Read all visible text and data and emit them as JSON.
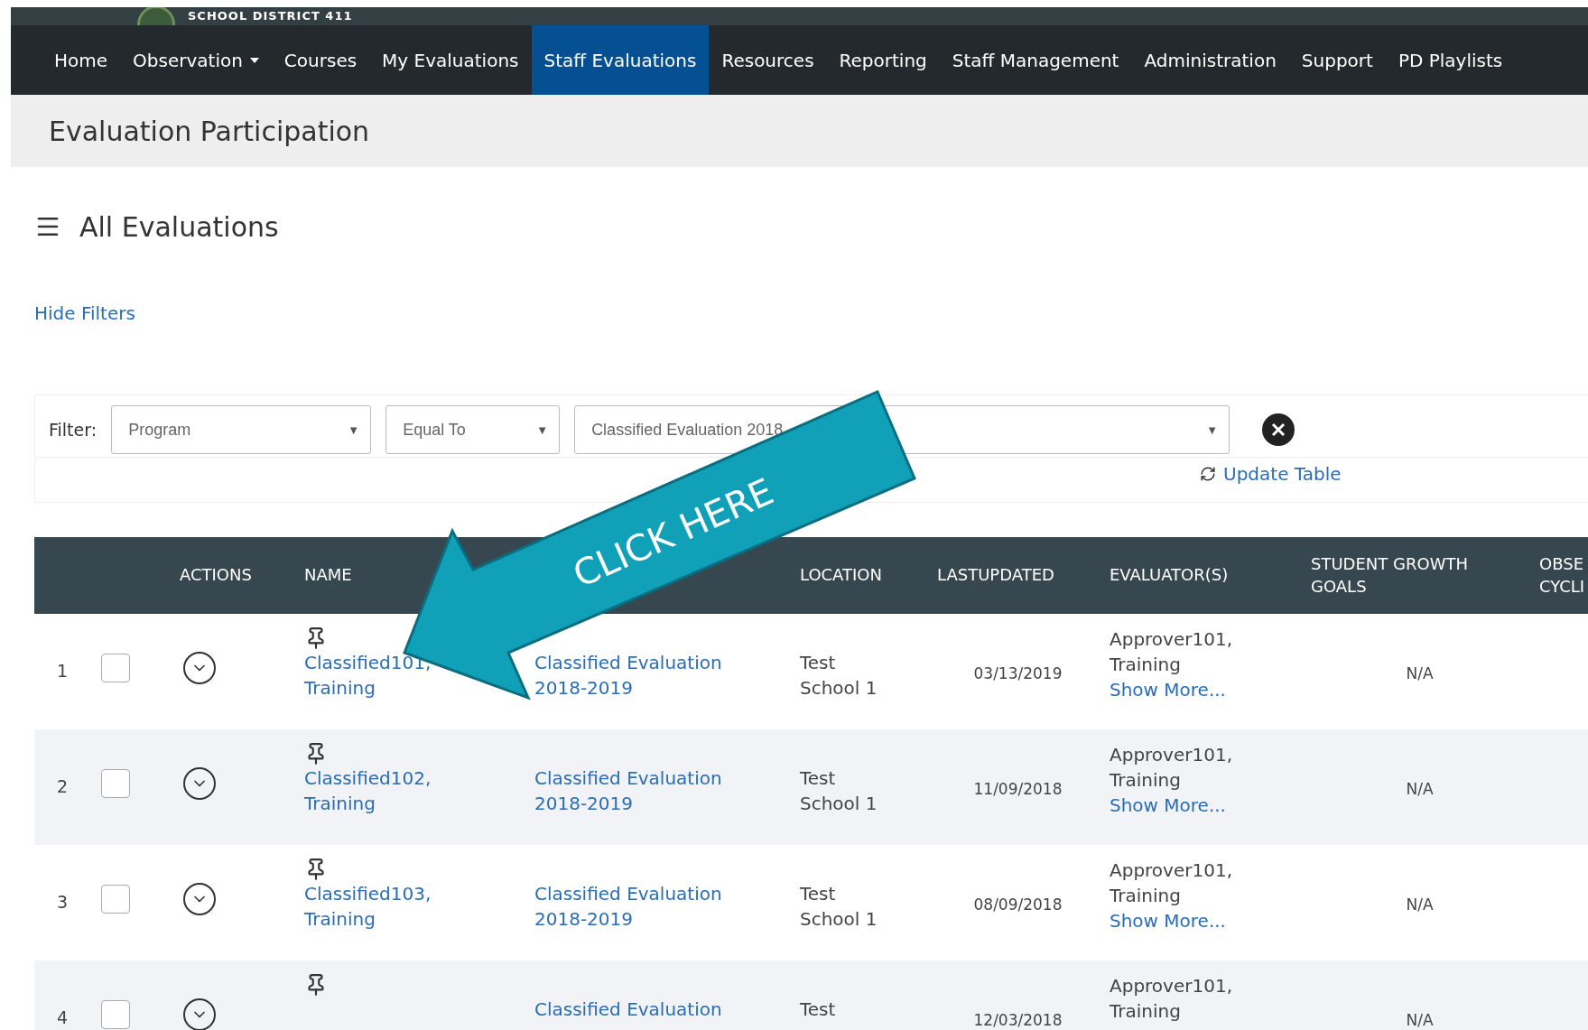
{
  "brand": {
    "name": "SCHOOL DISTRICT 411"
  },
  "nav": [
    {
      "label": "Home",
      "selected": false
    },
    {
      "label": "Observation",
      "selected": false,
      "dropdown": true
    },
    {
      "label": "Courses",
      "selected": false
    },
    {
      "label": "My Evaluations",
      "selected": false
    },
    {
      "label": "Staff Evaluations",
      "selected": true
    },
    {
      "label": "Resources",
      "selected": false
    },
    {
      "label": "Reporting",
      "selected": false
    },
    {
      "label": "Staff Management",
      "selected": false
    },
    {
      "label": "Administration",
      "selected": false
    },
    {
      "label": "Support",
      "selected": false
    },
    {
      "label": "PD Playlists",
      "selected": false
    }
  ],
  "page_title": "Evaluation Participation",
  "section_title": "All Evaluations",
  "hide_filters": "Hide Filters",
  "filter": {
    "label": "Filter:",
    "field": "Program",
    "operator": "Equal To",
    "value": "Classified Evaluation 2018",
    "caret": "▼",
    "update": "Update Table"
  },
  "callout": {
    "text": "CLICK HERE"
  },
  "table": {
    "columns": [
      "ACTIONS",
      "NAME",
      "LOCATION",
      "LASTUPDATED",
      "EVALUATOR(S)",
      "STUDENT GROWTH GOALS",
      "OBSE CYCLI"
    ],
    "rows": [
      {
        "num": "1",
        "checked": false,
        "name": [
          "Classified101,",
          "Training"
        ],
        "program": [
          "Classified Evaluation",
          "2018-2019"
        ],
        "location": [
          "Test",
          "School 1"
        ],
        "updated": "03/13/2019",
        "evaluators": [
          "Approver101,",
          "Training"
        ],
        "show_more": "Show More...",
        "goals": "N/A"
      },
      {
        "num": "2",
        "checked": false,
        "name": [
          "Classified102,",
          "Training"
        ],
        "program": [
          "Classified Evaluation",
          "2018-2019"
        ],
        "location": [
          "Test",
          "School 1"
        ],
        "updated": "11/09/2018",
        "evaluators": [
          "Approver101,",
          "Training"
        ],
        "show_more": "Show More...",
        "goals": "N/A"
      },
      {
        "num": "3",
        "checked": false,
        "name": [
          "Classified103,",
          "Training"
        ],
        "program": [
          "Classified Evaluation",
          "2018-2019"
        ],
        "location": [
          "Test",
          "School 1"
        ],
        "updated": "08/09/2018",
        "evaluators": [
          "Approver101,",
          "Training"
        ],
        "show_more": "Show More...",
        "goals": "N/A"
      },
      {
        "num": "4",
        "checked": false,
        "name": [],
        "program": [
          "Classified Evaluation"
        ],
        "location": [
          "Test"
        ],
        "updated": "12/03/2018",
        "evaluators": [
          "Approver101,",
          "Training"
        ],
        "goals": "N/A"
      }
    ]
  }
}
